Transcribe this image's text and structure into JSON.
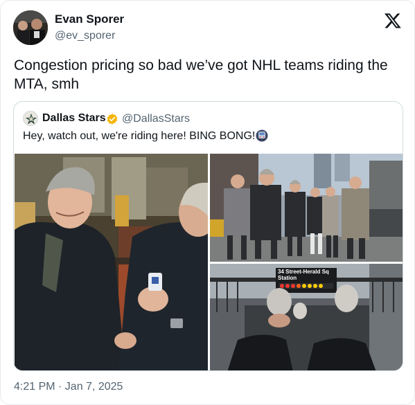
{
  "author": {
    "name": "Evan Sporer",
    "handle": "@ev_sporer"
  },
  "tweet": {
    "text": "Congestion pricing so bad we’ve got NHL teams riding the MTA, smh",
    "timestamp": "4:21 PM · Jan 7, 2025"
  },
  "quoted": {
    "name": "Dallas Stars",
    "handle": "@DallasStars",
    "text": "Hey, watch out, we're riding here! BING BONG!",
    "emoji_icon": "subway-train-icon",
    "verified_badge_color": "#f4b400"
  },
  "media": {
    "sign_line1": "34 Street-Herald Sq",
    "sign_line2": "Station"
  },
  "icons": {
    "platform": "x-logo-icon"
  }
}
